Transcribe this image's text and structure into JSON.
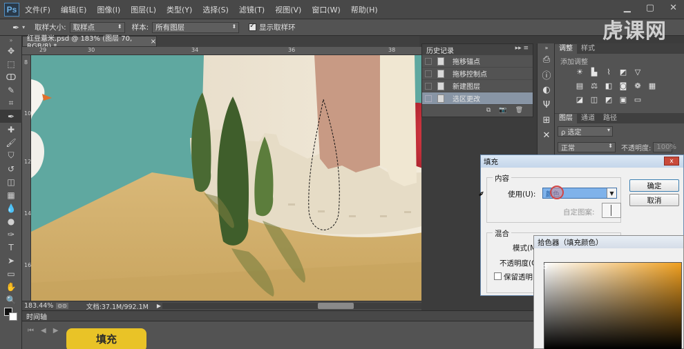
{
  "app": {
    "logo": "Ps",
    "watermark": "虎课网"
  },
  "menu": [
    "文件(F)",
    "编辑(E)",
    "图像(I)",
    "图层(L)",
    "类型(Y)",
    "选择(S)",
    "滤镜(T)",
    "视图(V)",
    "窗口(W)",
    "帮助(H)"
  ],
  "window_controls": [
    "minimize-icon",
    "maximize-icon",
    "close-icon"
  ],
  "options": {
    "sample_size_label": "取样大小:",
    "sample_size_value": "取样点",
    "sample_label": "样本:",
    "sample_value": "所有图层",
    "show_ring_label": "显示取样环",
    "show_ring_checked": true
  },
  "document": {
    "tab_title": "红豆薏米.psd @ 183% (图层 70, RGB/8) *",
    "tab_close": "×",
    "ruler_top_ticks": [
      "29",
      "30",
      "32",
      "34",
      "36",
      "38",
      "40",
      "42",
      "44",
      "46",
      "48",
      "50",
      "52",
      "54",
      "56",
      "58"
    ],
    "ruler_left_ticks": [
      "8",
      "10",
      "12",
      "14",
      "16",
      "18",
      "20",
      "22",
      "24",
      "26",
      "28",
      "30"
    ],
    "zoom": "183.44%",
    "doc_size": "文档:37.1M/992.1M"
  },
  "timeline": {
    "title": "时间轴",
    "caption": "填充"
  },
  "history": {
    "title": "历史记录",
    "items": [
      {
        "label": "拖移锚点",
        "selected": false
      },
      {
        "label": "拖移控制点",
        "selected": false
      },
      {
        "label": "新建图层",
        "selected": false
      },
      {
        "label": "选区更改",
        "selected": true
      }
    ]
  },
  "adjustments": {
    "tabs": [
      "调整",
      "样式"
    ],
    "hint": "添加调整"
  },
  "layers": {
    "tabs": [
      "图层",
      "通道",
      "路径"
    ],
    "kind_label": "ρ 选定",
    "blend_mode": "正常",
    "opacity_label": "不透明度:",
    "opacity_value": "100%"
  },
  "fill_dialog": {
    "title": "填充",
    "contents_group": "内容",
    "use_label": "使用(U):",
    "use_value": "颜色",
    "custom_pattern_label": "自定图案:",
    "blending_group": "混合",
    "mode_label": "模式(M",
    "opacity_label": "不透明度(O",
    "preserve_label": "保留透明区",
    "ok": "确定",
    "cancel": "取消",
    "close": "x"
  },
  "color_picker": {
    "title": "拾色器（填充颜色）"
  },
  "colors": {
    "accent_selected": "#8895a5",
    "caption_yellow": "#e9c327",
    "canvas_teal": "#5fa8a0",
    "canvas_sand": "#d6b374",
    "tree_green": "#4a6a33",
    "apple_red": "#c52a33"
  }
}
